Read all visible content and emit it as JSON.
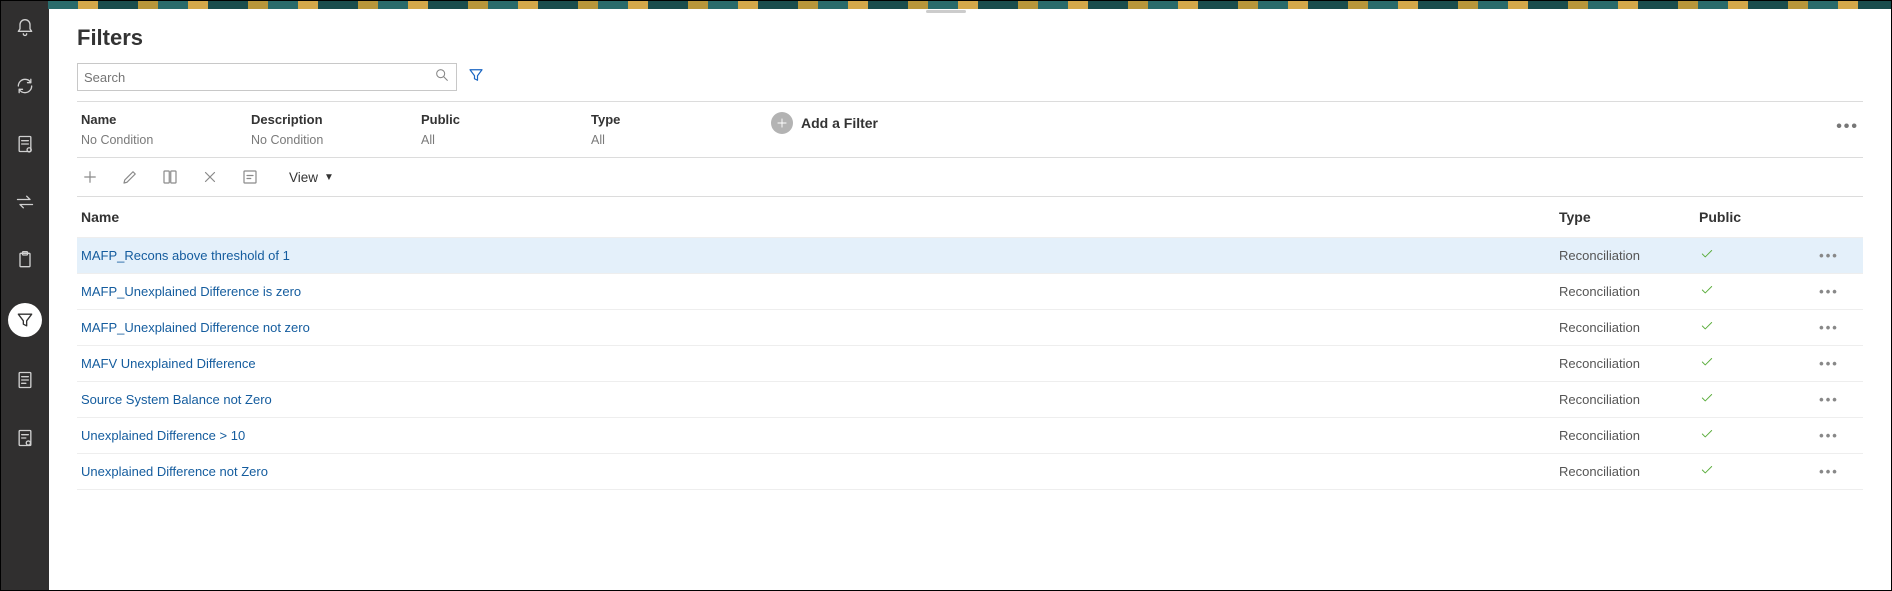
{
  "page_title": "Filters",
  "search": {
    "placeholder": "Search"
  },
  "filter_columns": [
    {
      "label": "Name",
      "value": "No Condition"
    },
    {
      "label": "Description",
      "value": "No Condition"
    },
    {
      "label": "Public",
      "value": "All"
    },
    {
      "label": "Type",
      "value": "All"
    }
  ],
  "add_filter_label": "Add a Filter",
  "view_label": "View",
  "table": {
    "headers": {
      "name": "Name",
      "type": "Type",
      "public": "Public"
    },
    "rows": [
      {
        "name": "MAFP_Recons above threshold of 1",
        "type": "Reconciliation",
        "public": true,
        "selected": true
      },
      {
        "name": "MAFP_Unexplained Difference is zero",
        "type": "Reconciliation",
        "public": true,
        "selected": false
      },
      {
        "name": "MAFP_Unexplained Difference not zero",
        "type": "Reconciliation",
        "public": true,
        "selected": false
      },
      {
        "name": "MAFV Unexplained Difference",
        "type": "Reconciliation",
        "public": true,
        "selected": false
      },
      {
        "name": "Source System Balance not Zero",
        "type": "Reconciliation",
        "public": true,
        "selected": false
      },
      {
        "name": "Unexplained Difference > 10",
        "type": "Reconciliation",
        "public": true,
        "selected": false
      },
      {
        "name": "Unexplained Difference not Zero",
        "type": "Reconciliation",
        "public": true,
        "selected": false
      }
    ]
  }
}
